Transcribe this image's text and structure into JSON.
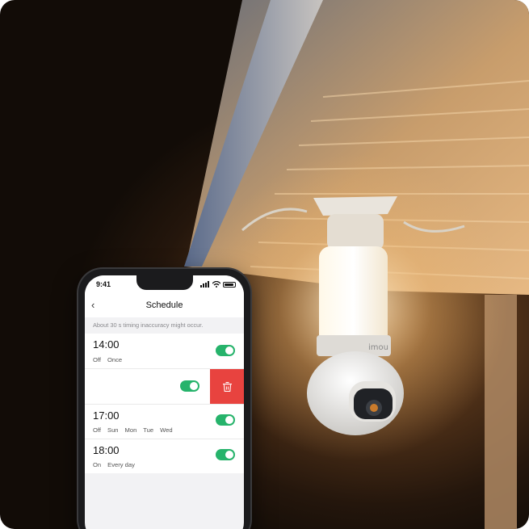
{
  "phone": {
    "status_time": "9:41",
    "screen_title": "Schedule",
    "hint": "About 30 s timing inaccuracy might occur.",
    "schedules": [
      {
        "time": "14:00",
        "state": "Off",
        "days": [
          "Once"
        ],
        "enabled": true
      },
      {
        "time": "",
        "state": "",
        "days": [],
        "enabled": true,
        "swiped": true
      },
      {
        "time": "17:00",
        "state": "Off",
        "days": [
          "Sun",
          "Mon",
          "Tue",
          "Wed"
        ],
        "enabled": true
      },
      {
        "time": "18:00",
        "state": "On",
        "days": [
          "Every day"
        ],
        "enabled": true
      }
    ]
  },
  "brand_logo": "imou",
  "colors": {
    "accent": "#26b36b",
    "delete": "#e8433f"
  }
}
